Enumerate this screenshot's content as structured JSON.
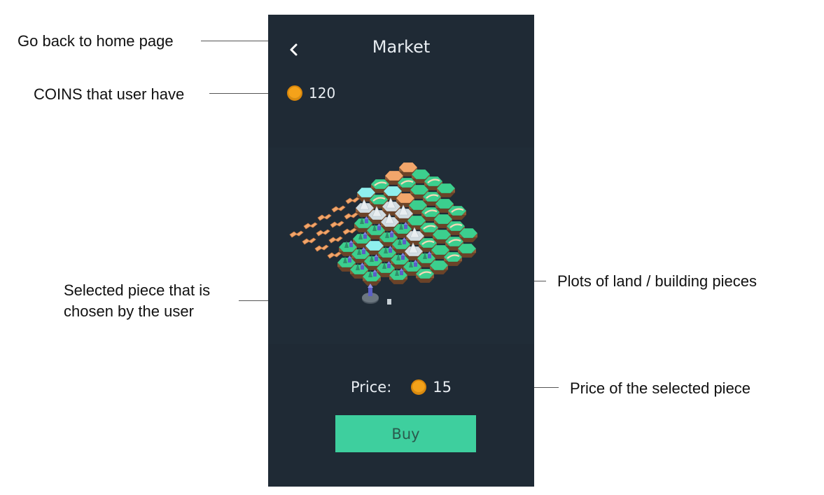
{
  "annotations": {
    "back": "Go back to home page",
    "coins": "COINS that user have",
    "selected_line1": "Selected piece that is",
    "selected_line2": "chosen by the user",
    "plots": "Plots of land / building pieces",
    "price": "Price of the selected piece"
  },
  "screen": {
    "title": "Market",
    "back_icon": "chevron-left-icon",
    "coins": "120",
    "price_label": "Price:",
    "price_value": "15",
    "buy_label": "Buy"
  },
  "colors": {
    "panel": "#1f2a35",
    "coin": "#f4a21a",
    "buy_button": "#3ecf9e",
    "tile_green": "#3ccf8e",
    "tile_orange": "#f2a66b",
    "tile_cyan": "#8ff0ee",
    "tile_grey": "#d3dde2"
  },
  "board": {
    "rows": [
      "OGGG",
      "OGGGGG",
      "GCOGGGGG",
      "CGMMGGGGG",
      "PMMMTMGGG",
      "PPTTTTMTG",
      "PPPTCTTTG",
      "PPPTTTTT",
      "PPPPTTT"
    ]
  }
}
